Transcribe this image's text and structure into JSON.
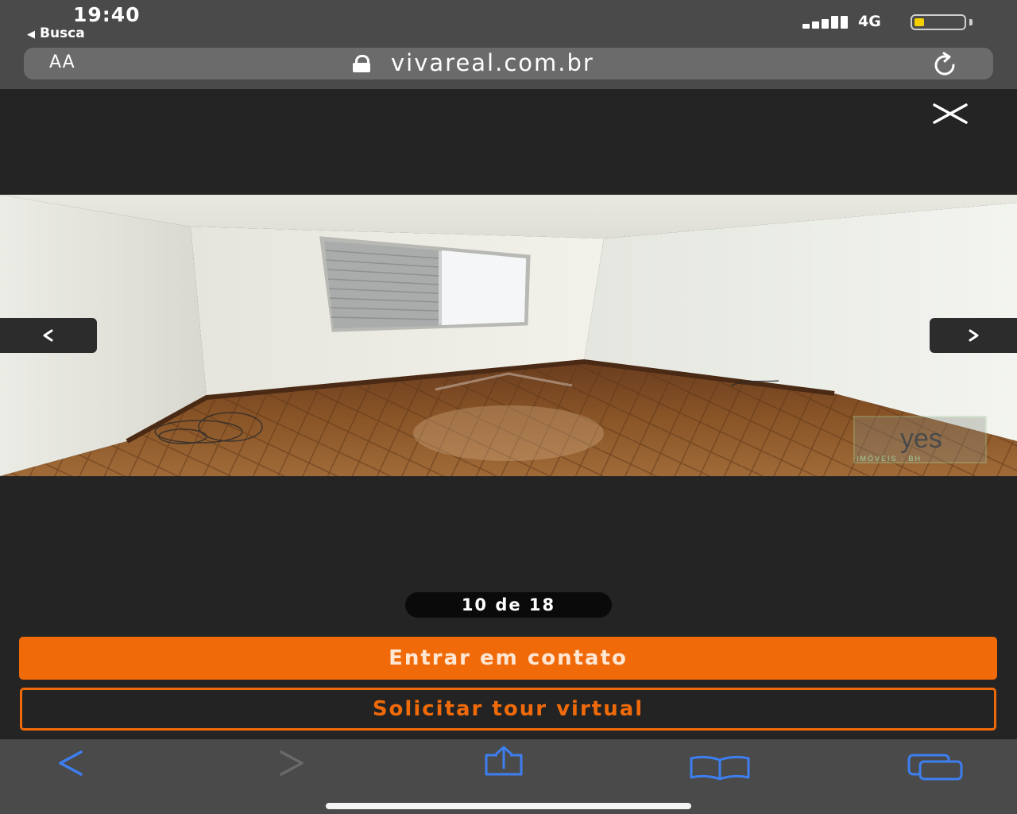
{
  "status_bar": {
    "time": "19:40",
    "back_app": "Busca",
    "network": "4G",
    "battery_level": 0.2,
    "battery_color": "#f5d000"
  },
  "address_bar": {
    "text_size_label": "AA",
    "url": "vivareal.com.br",
    "lock_icon": "lock-icon",
    "reload_icon": "reload-icon"
  },
  "viewer": {
    "close_icon": "close-icon",
    "prev_icon": "chevron-left-icon",
    "next_icon": "chevron-right-icon",
    "counter": "10 de 18",
    "current_index": 10,
    "total": 18,
    "watermark_brand": "yes",
    "watermark_sub": "IMÓVEIS · BH"
  },
  "actions": {
    "contact_label": "Entrar em contato",
    "tour_label": "Solicitar tour virtual",
    "accent_color": "#f06a0a"
  },
  "toolbar": {
    "back_icon": "back-arrow-icon",
    "forward_icon": "forward-arrow-icon",
    "share_icon": "share-icon",
    "bookmarks_icon": "book-icon",
    "tabs_icon": "tabs-icon",
    "icon_color": "#3d7ff0"
  }
}
